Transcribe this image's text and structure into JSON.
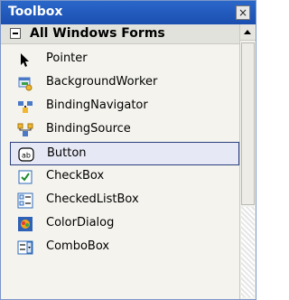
{
  "window": {
    "title": "Toolbox",
    "close_glyph": "×"
  },
  "category": {
    "label": "All Windows Forms",
    "expanded": true
  },
  "items": [
    {
      "label": "Pointer",
      "icon": "pointer-icon"
    },
    {
      "label": "BackgroundWorker",
      "icon": "background-worker-icon"
    },
    {
      "label": "BindingNavigator",
      "icon": "binding-navigator-icon"
    },
    {
      "label": "BindingSource",
      "icon": "binding-source-icon"
    },
    {
      "label": "Button",
      "icon": "button-icon",
      "selected": true
    },
    {
      "label": "CheckBox",
      "icon": "checkbox-icon"
    },
    {
      "label": "CheckedListBox",
      "icon": "checked-listbox-icon"
    },
    {
      "label": "ColorDialog",
      "icon": "color-dialog-icon"
    },
    {
      "label": "ComboBox",
      "icon": "combobox-icon"
    }
  ],
  "icon_text": {
    "button": "ab"
  },
  "colors": {
    "title_bar": "#1f56b8",
    "selection_border": "#2b3f7a",
    "selection_fill": "#e6e9f5"
  }
}
